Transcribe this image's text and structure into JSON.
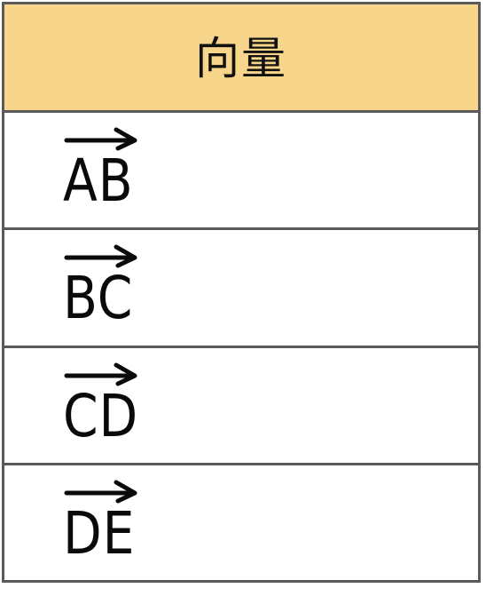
{
  "table": {
    "header": "向量",
    "rows": [
      {
        "vector": "AB"
      },
      {
        "vector": "BC"
      },
      {
        "vector": "CD"
      },
      {
        "vector": "DE"
      }
    ]
  },
  "colors": {
    "header_bg": "#f7d68c",
    "border": "#5a5a5a",
    "text": "#111111"
  },
  "icons": {
    "vector_arrow": "right-arrow-overline-icon"
  }
}
